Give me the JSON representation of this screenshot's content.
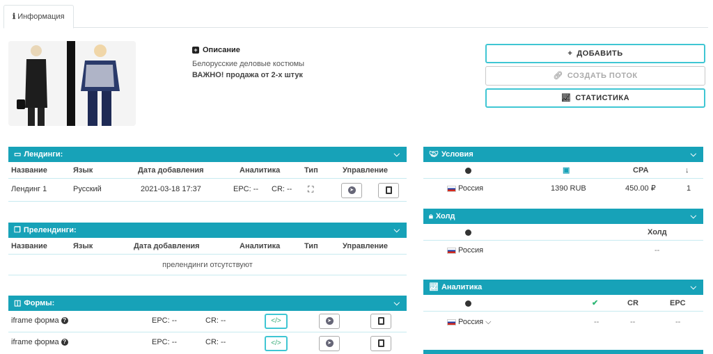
{
  "tab": {
    "label": "Информация",
    "icon": "info-icon"
  },
  "description": {
    "title": "Описание",
    "line1": "Белорусские деловые костюмы",
    "line2": "ВАЖНО! продажа от 2-х штук"
  },
  "actions": {
    "add": "ДОБАВИТЬ",
    "create_stream": "СОЗДАТЬ ПОТОК",
    "stats": "СТАТИСТИКА"
  },
  "landings": {
    "title": "Лендинги:",
    "headers": [
      "Название",
      "Язык",
      "Дата добавления",
      "Аналитика",
      "Тип",
      "Управление"
    ],
    "rows": [
      {
        "name": "Лендинг 1",
        "lang": "Русский",
        "date": "2021-03-18 17:37",
        "epc": "EPC: --",
        "cr": "CR: --"
      }
    ]
  },
  "prelandings": {
    "title": "Прелендинги:",
    "headers": [
      "Название",
      "Язык",
      "Дата добавления",
      "Аналитика",
      "Тип",
      "Управление"
    ],
    "empty": "прелендинги отсутствуют"
  },
  "forms": {
    "title": "Формы:",
    "rows": [
      {
        "name": "iframe форма",
        "epc": "EPC: --",
        "cr": "CR: --",
        "code": "</>"
      },
      {
        "name": "iframe форма",
        "epc": "EPC: --",
        "cr": "CR: --",
        "code": "</>"
      }
    ]
  },
  "conditions": {
    "title": "Условия",
    "headers": {
      "cpa": "CPA"
    },
    "row": {
      "country": "Россия",
      "price": "1390 RUB",
      "cpa": "450.00 ₽",
      "level": "1"
    }
  },
  "hold": {
    "title": "Холд",
    "header": "Холд",
    "row": {
      "country": "Россия",
      "value": "--"
    }
  },
  "analytics": {
    "title": "Аналитика",
    "headers": {
      "cr": "CR",
      "epc": "EPC"
    },
    "row": {
      "country": "Россия",
      "approve": "--",
      "cr": "--",
      "epc": "--"
    }
  },
  "colors": {
    "accent": "#17a2b8",
    "button_border": "#3fc6d3"
  }
}
